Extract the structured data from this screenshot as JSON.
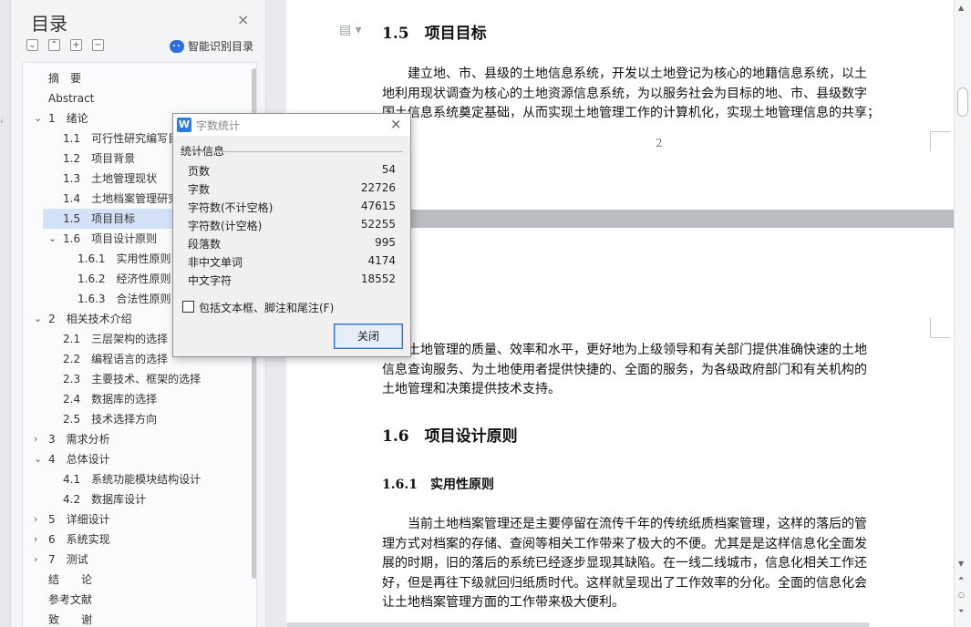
{
  "toc": {
    "title": "目录",
    "close_icon": "×",
    "buttons": [
      "⌄",
      "⌃",
      "+",
      "−"
    ],
    "smart_label": "智能识别目录",
    "items": [
      {
        "label": "摘　要",
        "level": 0,
        "arrow": ""
      },
      {
        "label": "Abstract",
        "level": 0,
        "arrow": ""
      },
      {
        "label": "1　绪论",
        "level": 0,
        "arrow": "⌄"
      },
      {
        "label": "1.1　可行性研究编写目的",
        "level": 1,
        "arrow": ""
      },
      {
        "label": "1.2　项目背景",
        "level": 1,
        "arrow": ""
      },
      {
        "label": "1.3　土地管理现状",
        "level": 1,
        "arrow": ""
      },
      {
        "label": "1.4　土地档案管理研究",
        "level": 1,
        "arrow": ""
      },
      {
        "label": "1.5　项目目标",
        "level": 1,
        "arrow": "",
        "selected": true
      },
      {
        "label": "1.6　项目设计原则",
        "level": 1,
        "arrow": "⌄"
      },
      {
        "label": "1.6.1　实用性原则",
        "level": 2,
        "arrow": ""
      },
      {
        "label": "1.6.2　经济性原则",
        "level": 2,
        "arrow": ""
      },
      {
        "label": "1.6.3　合法性原则",
        "level": 2,
        "arrow": ""
      },
      {
        "label": "2　相关技术介绍",
        "level": 0,
        "arrow": "⌄"
      },
      {
        "label": "2.1　三层架构的选择",
        "level": 1,
        "arrow": ""
      },
      {
        "label": "2.2　编程语言的选择",
        "level": 1,
        "arrow": ""
      },
      {
        "label": "2.3　主要技术、框架的选择",
        "level": 1,
        "arrow": ""
      },
      {
        "label": "2.4　数据库的选择",
        "level": 1,
        "arrow": ""
      },
      {
        "label": "2.5　技术选择方向",
        "level": 1,
        "arrow": ""
      },
      {
        "label": "3　需求分析",
        "level": 0,
        "arrow": "›"
      },
      {
        "label": "4　总体设计",
        "level": 0,
        "arrow": "⌄"
      },
      {
        "label": "4.1　系统功能模块结构设计",
        "level": 1,
        "arrow": ""
      },
      {
        "label": "4.2　数据库设计",
        "level": 1,
        "arrow": ""
      },
      {
        "label": "5　详细设计",
        "level": 0,
        "arrow": "›"
      },
      {
        "label": "6　系统实现",
        "level": 0,
        "arrow": "›"
      },
      {
        "label": "7　测试",
        "level": 0,
        "arrow": "›"
      },
      {
        "label": "结　　论",
        "level": 0,
        "arrow": ""
      },
      {
        "label": "参考文献",
        "level": 0,
        "arrow": ""
      },
      {
        "label": "致　　谢",
        "level": 0,
        "arrow": ""
      }
    ]
  },
  "document": {
    "h_15": "1.5　项目目标",
    "p1": [
      "　　建立地、市、县级的土地信息系统，开发以土地登记为核心的地籍信息系统，以土",
      "地利用现状调查为核心的土地资源信息系统，为以服务社会为目标的地、市、县级数字",
      "国土信息系统奠定基础，从而实现土地管理工作的计算机化，实现土地管理信息的共享；"
    ],
    "page_number": "2",
    "p2": [
      "提高土地管理的质量、效率和水平，更好地为上级领导和有关部门提供准确快速的土地",
      "信息查询服务、为土地使用者提供快捷的、全面的服务，为各级政府部门和有关机构的",
      "土地管理和决策提供技术支持。"
    ],
    "h_16": "1.6　项目设计原则",
    "h_161": "1.6.1　实用性原则",
    "p3": [
      "　　当前土地档案管理还是主要停留在流传千年的传统纸质档案管理，这样的落后的管",
      "理方式对档案的存储、查阅等相关工作带来了极大的不便。尤其是是这样信息化全面发",
      "展的时期，旧的落后的系统已经逐步显现其缺陷。在一线二线城市，信息化相关工作还",
      "好，但是再往下级就回归纸质时代。这样就呈现出了工作效率的分化。全面的信息化会",
      "让土地档案管理方面的工作带来极大便利。"
    ]
  },
  "dialog": {
    "icon_letter": "W",
    "title": "字数统计",
    "close_icon": "×",
    "section": "统计信息",
    "stats": [
      {
        "label": "页数",
        "value": "54"
      },
      {
        "label": "字数",
        "value": "22726"
      },
      {
        "label": "字符数(不计空格)",
        "value": "47615"
      },
      {
        "label": "字符数(计空格)",
        "value": "52255"
      },
      {
        "label": "段落数",
        "value": "995"
      },
      {
        "label": "非中文单词",
        "value": "4174"
      },
      {
        "label": "中文字符",
        "value": "18552"
      }
    ],
    "checkbox_label": "包括文本框、脚注和尾注(F)",
    "checkbox_checked": false,
    "close_button": "关闭"
  }
}
